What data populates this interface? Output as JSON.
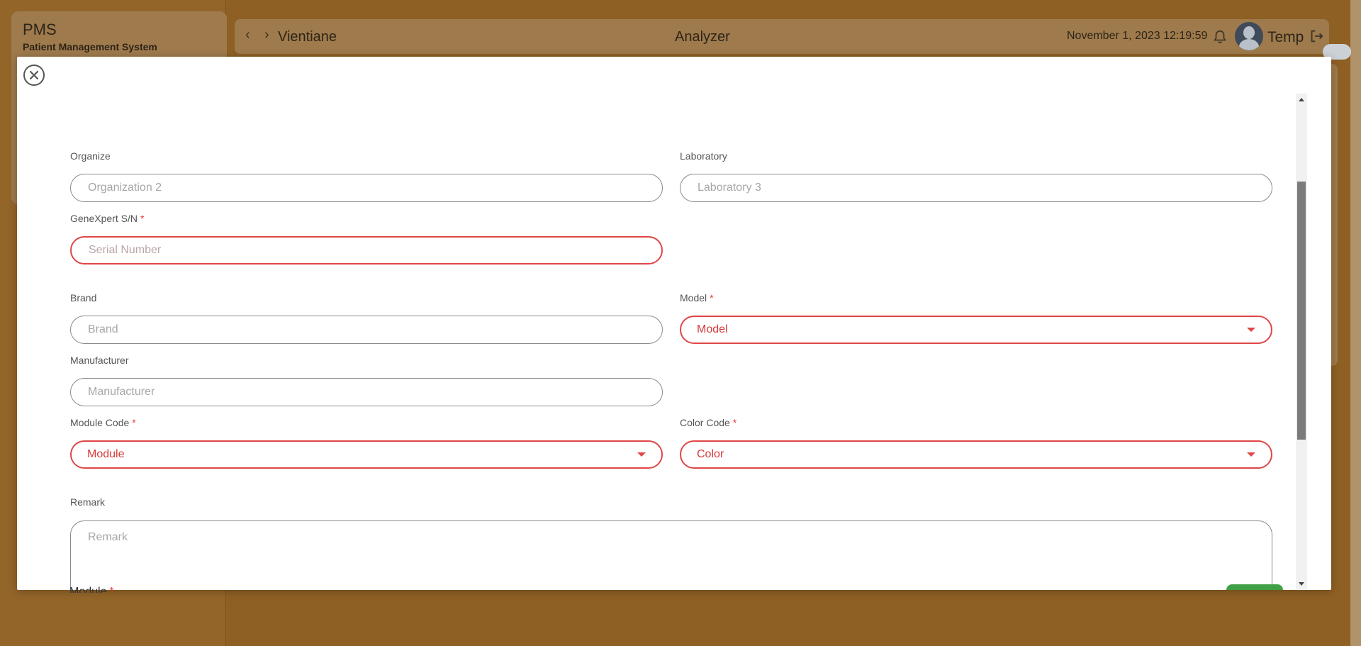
{
  "app": {
    "brand": "PMS",
    "brand_subtitle": "Patient Management System"
  },
  "topbar": {
    "location": "Vientiane",
    "title": "Analyzer",
    "datetime": "November 1, 2023 12:19:59",
    "user": "Temp"
  },
  "form": {
    "organize": {
      "label": "Organize",
      "placeholder": "Organization 2"
    },
    "laboratory": {
      "label": "Laboratory",
      "placeholder": "Laboratory 3"
    },
    "serial": {
      "label": "GeneXpert S/N",
      "required": "*",
      "placeholder": "Serial Number"
    },
    "brand": {
      "label": "Brand",
      "placeholder": "Brand"
    },
    "model": {
      "label": "Model",
      "required": "*",
      "value": "Model"
    },
    "manufacturer": {
      "label": "Manufacturer",
      "placeholder": "Manufacturer"
    },
    "module_code": {
      "label": "Module Code",
      "required": "*",
      "value": "Module"
    },
    "color_code": {
      "label": "Color Code",
      "required": "*",
      "value": "Color"
    },
    "remark": {
      "label": "Remark",
      "placeholder": "Remark"
    },
    "next_section": {
      "label": "Module",
      "required": "*"
    }
  },
  "colors": {
    "error": "#e04646",
    "overlay": "#8e6024",
    "accent_green": "#3fa046"
  }
}
